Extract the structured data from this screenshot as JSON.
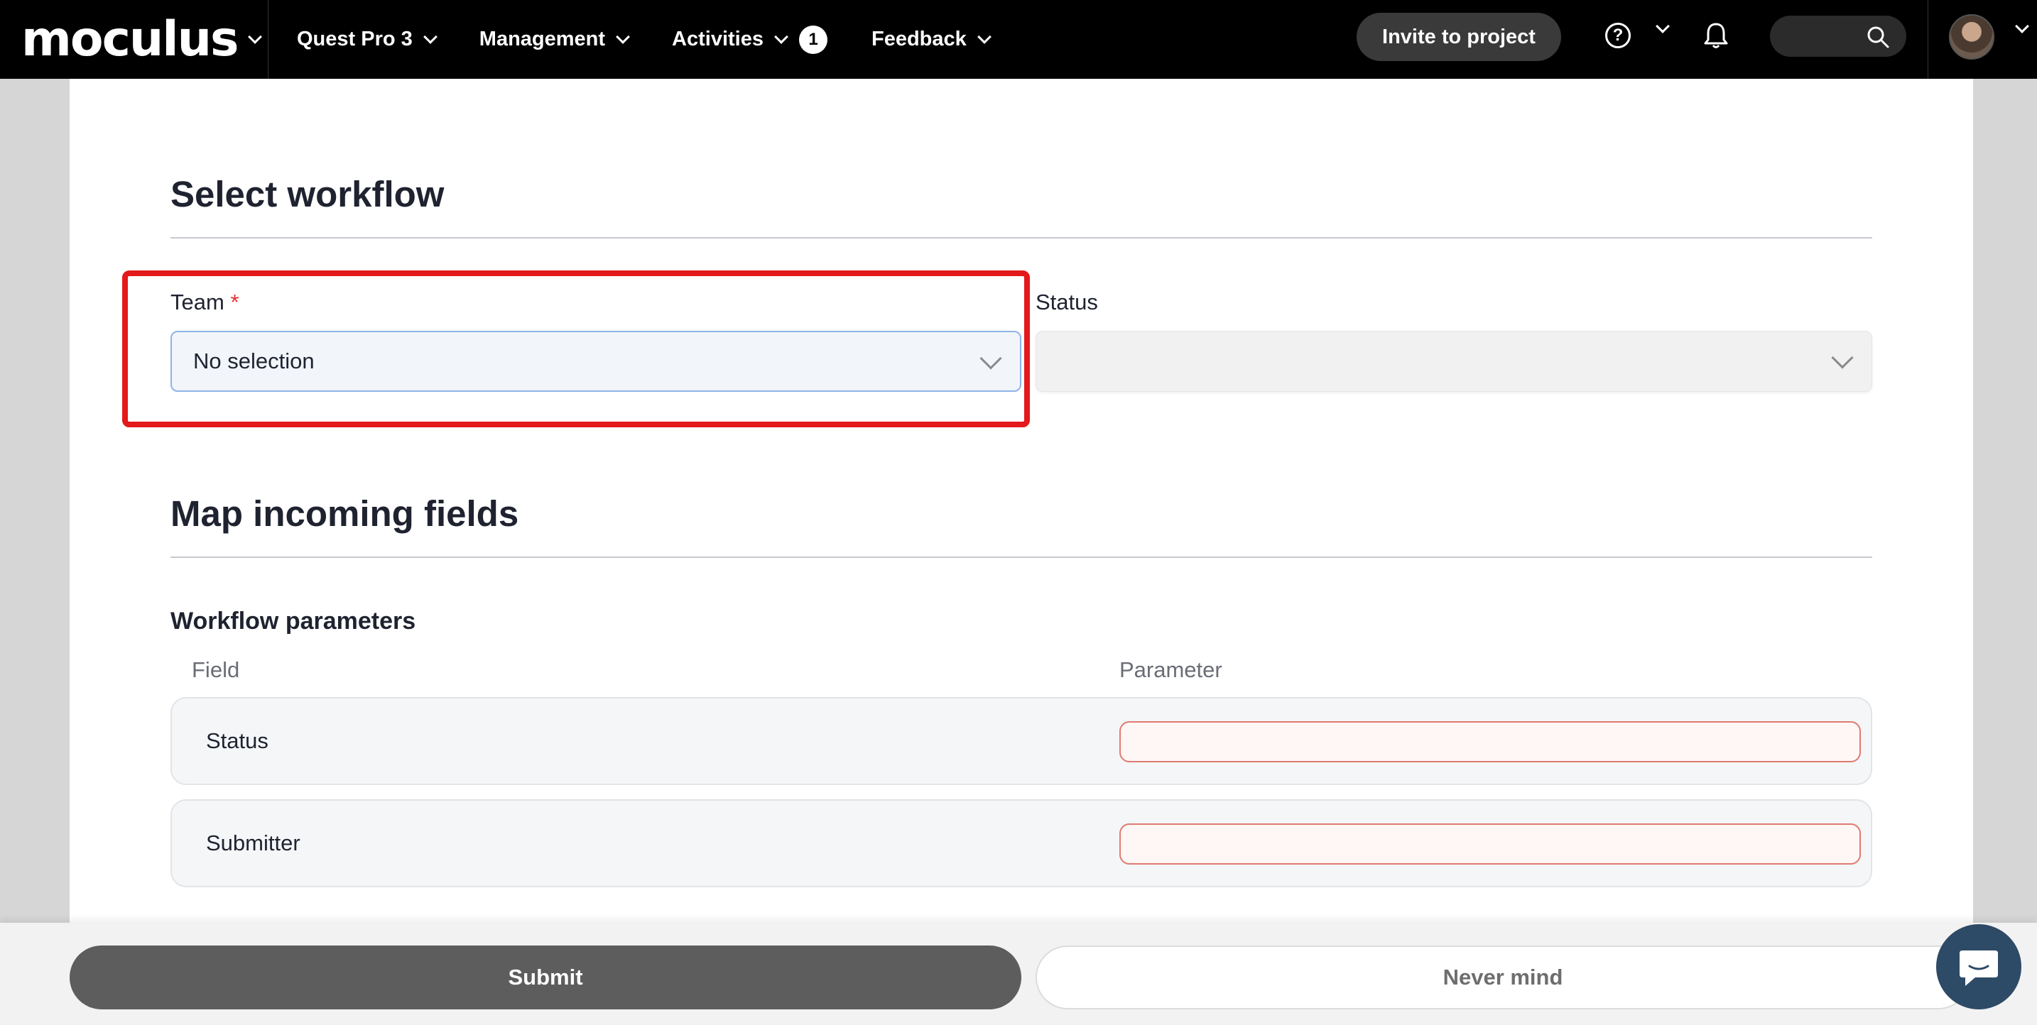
{
  "topbar": {
    "logo": "moculus",
    "nav": [
      {
        "label": "Quest Pro 3"
      },
      {
        "label": "Management"
      },
      {
        "label": "Activities",
        "badge": "1"
      },
      {
        "label": "Feedback"
      }
    ],
    "invite_label": "Invite to project",
    "help_glyph": "?"
  },
  "workflow": {
    "title": "Select workflow",
    "team_label": "Team",
    "required_mark": "*",
    "team_value": "No selection",
    "status_label": "Status",
    "status_value": ""
  },
  "mapping": {
    "title": "Map incoming fields",
    "subtitle": "Workflow parameters",
    "col_field": "Field",
    "col_parameter": "Parameter",
    "rows": [
      {
        "field": "Status",
        "parameter": ""
      },
      {
        "field": "Submitter",
        "parameter": ""
      }
    ]
  },
  "footer": {
    "submit_label": "Submit",
    "cancel_label": "Never mind"
  },
  "colors": {
    "highlight": "#e3191b",
    "error_border": "#e07b72",
    "submit_bg": "#5d5d5d"
  }
}
